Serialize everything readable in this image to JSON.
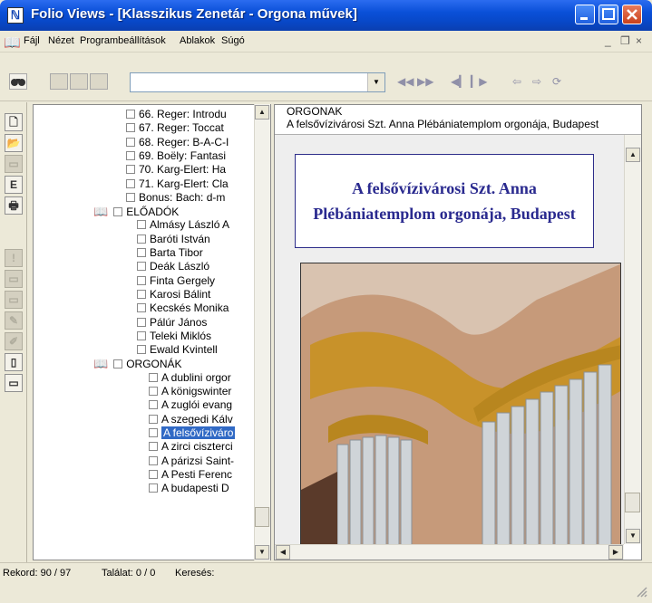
{
  "window": {
    "title": "Folio Views - [Klasszikus Zenetár - Orgona művek]",
    "icon": "book-icon"
  },
  "menu": {
    "items": [
      "Fájl",
      "Nézet",
      "Programbeállítások",
      "Ablakok",
      "Súgó"
    ],
    "mdi_minimize": "_",
    "mdi_restore": "❐",
    "mdi_close": "×"
  },
  "toolbar": {
    "search_value": ""
  },
  "tree": {
    "items": [
      {
        "label": "66. Reger: Introdu",
        "level": 2
      },
      {
        "label": "67. Reger: Toccat",
        "level": 2
      },
      {
        "label": "68. Reger: B-A-C-I",
        "level": 2
      },
      {
        "label": "69. Boëly: Fantasi",
        "level": 2
      },
      {
        "label": "70. Karg-Elert: Ha",
        "level": 2
      },
      {
        "label": "71. Karg-Elert: Cla",
        "level": 2
      },
      {
        "label": "Bonus: Bach: d-m",
        "level": 2
      },
      {
        "label": "ELŐADÓK",
        "level": 0
      },
      {
        "label": "Almásy László A",
        "level": 1
      },
      {
        "label": "Baróti István",
        "level": 1
      },
      {
        "label": "Barta Tibor",
        "level": 1
      },
      {
        "label": "Deák László",
        "level": 1
      },
      {
        "label": "Finta Gergely",
        "level": 1
      },
      {
        "label": "Karosi Bálint",
        "level": 1
      },
      {
        "label": "Kecskés Monika",
        "level": 1
      },
      {
        "label": "Pálúr János",
        "level": 1
      },
      {
        "label": "Teleki Miklós",
        "level": 1
      },
      {
        "label": "Ewald Kvintell",
        "level": 1
      },
      {
        "label": "ORGONÁK",
        "level": 0
      },
      {
        "label": "A dublini orgor",
        "level": 2
      },
      {
        "label": "A königswinter",
        "level": 2
      },
      {
        "label": "A zuglói evang",
        "level": 2
      },
      {
        "label": "A szegedi Kálv",
        "level": 2
      },
      {
        "label": "A felsővíziváro",
        "level": 2,
        "selected": true
      },
      {
        "label": "A zirci ciszterci",
        "level": 2
      },
      {
        "label": "A párizsi Saint-",
        "level": 2
      },
      {
        "label": "A Pesti Ferenc",
        "level": 2
      },
      {
        "label": "A budapesti D",
        "level": 2
      }
    ]
  },
  "document": {
    "header_section": "ORGONAK",
    "header_path": "A felsővízivárosi Szt. Anna Plébániatemplom orgonája, Budapest",
    "title": "A felsővízivárosi Szt. Anna Plébániatemplom orgonája, Budapest"
  },
  "status": {
    "record": "Rekord: 90 / 97",
    "hits": "Találat: 0 / 0",
    "search": "Keresés:"
  },
  "colors": {
    "titlebar": "#0a50d8",
    "selection": "#316ac5",
    "doc_title": "#2a2a8f"
  }
}
